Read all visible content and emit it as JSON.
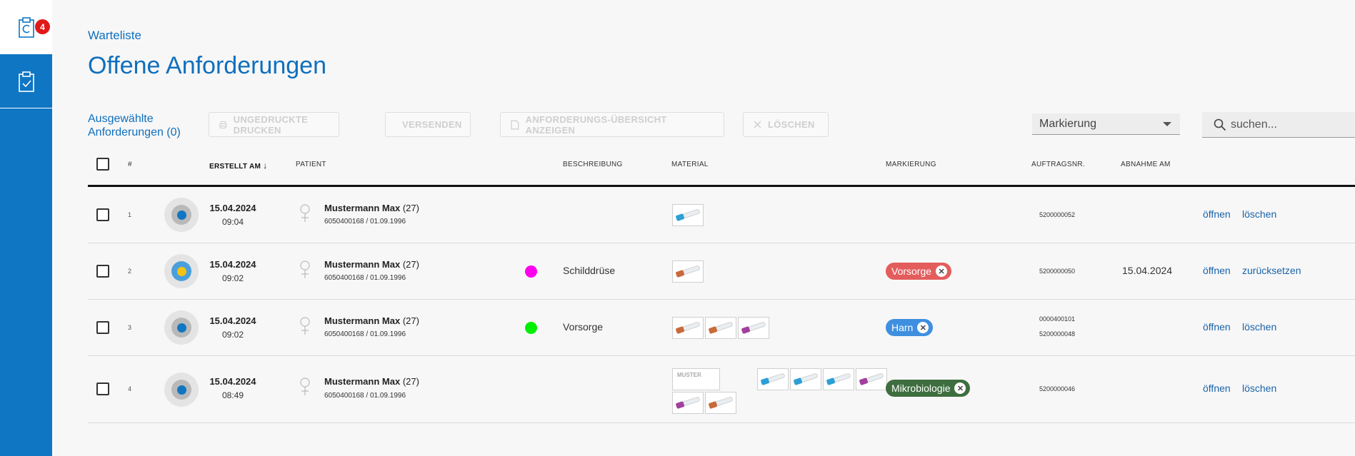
{
  "sidebar": {
    "badge_count": "4",
    "items": [
      {
        "icon": "clipboard-refresh-icon"
      },
      {
        "icon": "clipboard-check-icon"
      }
    ]
  },
  "breadcrumb": "Warteliste",
  "title": "Offene Anforderungen",
  "toolbar": {
    "selected_line1": "Ausgewählte",
    "selected_line2": "Anforderungen (0)",
    "print_label": "UNGEDRUCKTE DRUCKEN",
    "send_label": "VERSENDEN",
    "overview_label": "ANFORDERUNGS-ÜBERSICHT ANZEIGEN",
    "delete_label": "LÖSCHEN"
  },
  "filter": {
    "marker_value": "Markierung"
  },
  "search": {
    "placeholder": "suchen..."
  },
  "columns": {
    "num": "#",
    "created": "ERSTELLT AM",
    "patient": "PATIENT",
    "description": "BESCHREIBUNG",
    "material": "MATERIAL",
    "marker": "MARKIERUNG",
    "order_no": "AUFTRAGSNR.",
    "collected": "ABNAHME AM"
  },
  "rows": [
    {
      "num": "1",
      "date": "15.04.2024",
      "time": "09:04",
      "patient_name": "Mustermann Max",
      "patient_age": "(27)",
      "patient_id": "6050400168 / 01.09.1996",
      "description": "",
      "desc_color": "",
      "tag": "",
      "tag_color": "",
      "order1": "5200000052",
      "order2": "",
      "collected": "",
      "open": "öffnen",
      "action": "löschen",
      "status_color": "#0f76c4"
    },
    {
      "num": "2",
      "date": "15.04.2024",
      "time": "09:02",
      "patient_name": "Mustermann Max",
      "patient_age": "(27)",
      "patient_id": "6050400168 / 01.09.1996",
      "description": "Schilddrüse",
      "desc_color": "#ff00ee",
      "tag": "Vorsorge",
      "tag_color": "#e35d5d",
      "order1": "5200000050",
      "order2": "",
      "collected": "15.04.2024",
      "open": "öffnen",
      "action": "zurücksetzen",
      "status_color": "#f2c315"
    },
    {
      "num": "3",
      "date": "15.04.2024",
      "time": "09:02",
      "patient_name": "Mustermann Max",
      "patient_age": "(27)",
      "patient_id": "6050400168 / 01.09.1996",
      "description": "Vorsorge",
      "desc_color": "#00ee00",
      "tag": "Harn",
      "tag_color": "#3f8fe0",
      "order1": "0000400101",
      "order2": "5200000048",
      "collected": "",
      "open": "öffnen",
      "action": "löschen",
      "status_color": "#0f76c4"
    },
    {
      "num": "4",
      "date": "15.04.2024",
      "time": "08:49",
      "patient_name": "Mustermann Max",
      "patient_age": "(27)",
      "patient_id": "6050400168 / 01.09.1996",
      "description": "",
      "desc_color": "",
      "tag": "Mikrobiologie",
      "tag_color": "#3e6e3f",
      "order1": "5200000046",
      "order2": "",
      "collected": "",
      "open": "öffnen",
      "action": "löschen",
      "status_color": "#0f76c4"
    }
  ],
  "materials": {
    "sample_label": "MUSTER",
    "cap_colors": {
      "blue": "#2d9fd6",
      "orange": "#c96a3a",
      "purple": "#a2409e"
    }
  }
}
